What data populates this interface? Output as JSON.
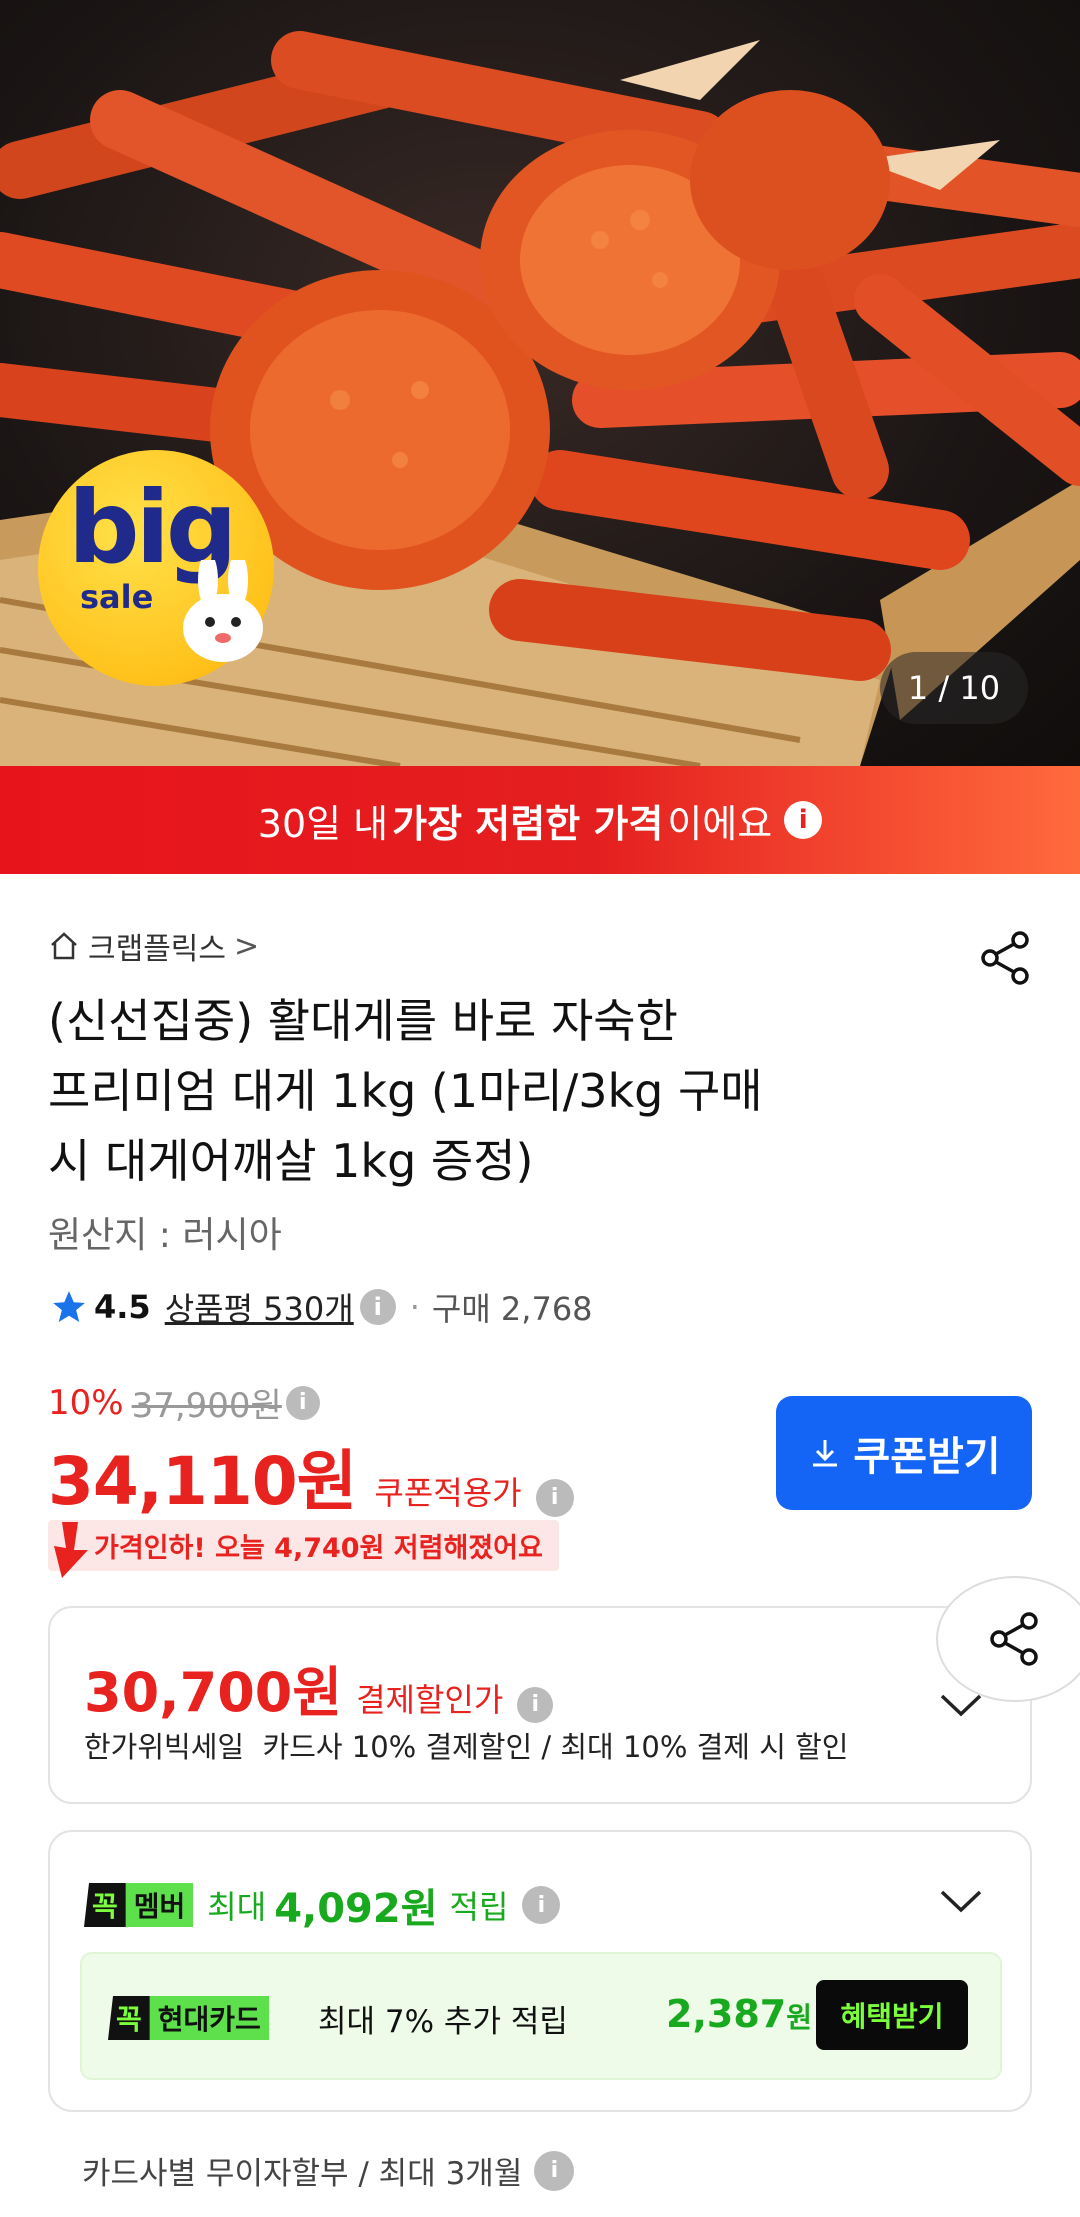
{
  "hero": {
    "counter": "1 / 10",
    "badge_big": "big",
    "badge_sale": "sale"
  },
  "banner": {
    "pre": "30일 내 ",
    "bold": "가장 저렴한 가격",
    "post": "이에요",
    "info": "i"
  },
  "store": {
    "name": "크랩플릭스",
    "arrow": ">"
  },
  "product": {
    "title_line1": "(신선집중) 활대게를 바로 자숙한",
    "title_line2": "프리미엄 대게 1kg (1마리/3kg 구매",
    "title_line3": "시 대게어깨살 1kg 증정)",
    "origin": "원산지 : 러시아"
  },
  "rating": {
    "score": "4.5",
    "review_label": "상품평 530개",
    "dot": "·",
    "purchases": "구매 2,768"
  },
  "pricing": {
    "discount_pct": "10%",
    "original_price": "37,900원",
    "price": "34,110원",
    "price_label": "쿠폰적용가",
    "coupon_button": "쿠폰받기",
    "drop_text": "가격인하! 오늘 4,740원 저렴해졌어요"
  },
  "payment": {
    "price": "30,700원",
    "label": "결제할인가",
    "desc": "한가위빅세일  카드사 10% 결제할인 / 최대 10% 결제 시 할인"
  },
  "membership": {
    "tag_k": "꼭",
    "tag_m": "멤버",
    "prefix": "최대",
    "amount": "4,092원",
    "suffix": "적립",
    "card_tag": "현대카드",
    "card_text": "최대 7% 추가 적립",
    "card_amount": "2,387",
    "card_unit": "원",
    "card_button": "혜택받기"
  },
  "installment": {
    "text": "카드사별 무이자할부 / 최대 3개월"
  },
  "colors": {
    "accent_red": "#e8221f",
    "coupon_blue": "#1464f6",
    "green": "#19a91e"
  }
}
